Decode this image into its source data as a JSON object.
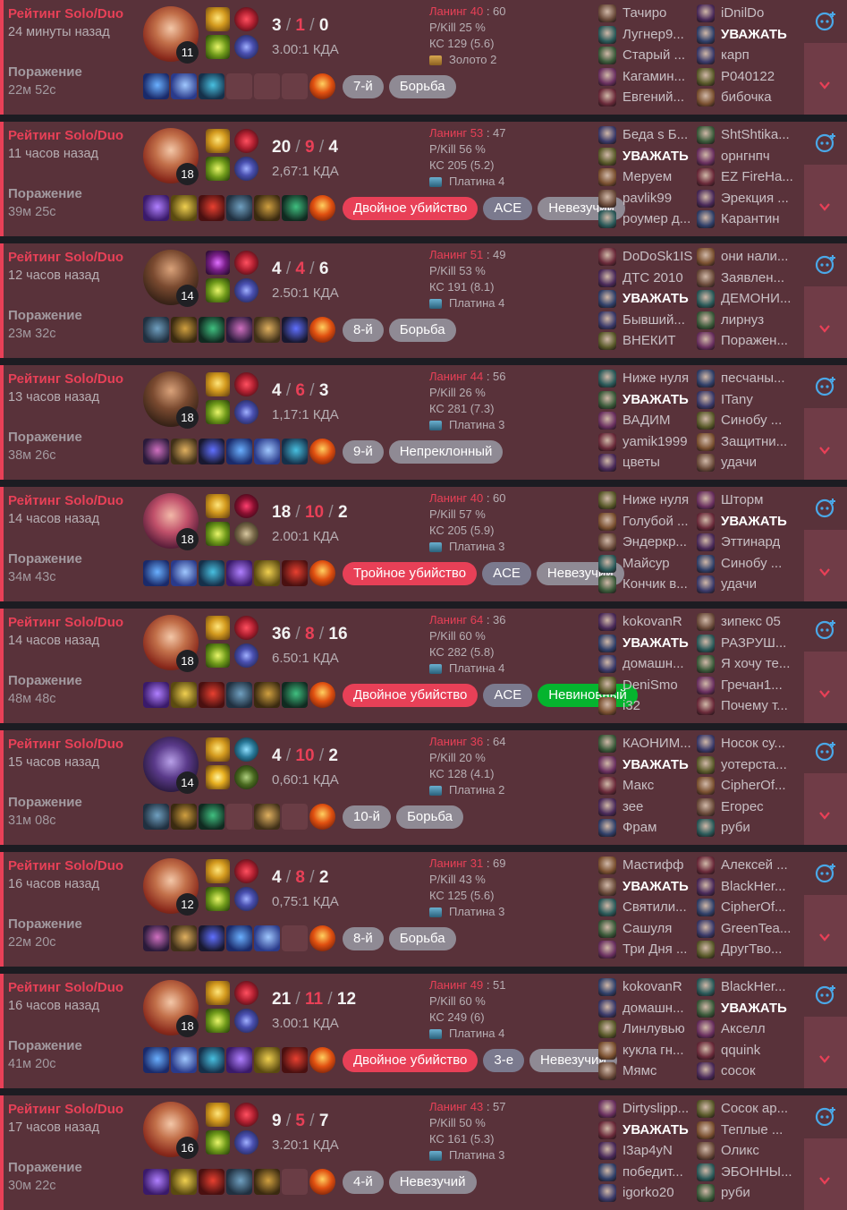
{
  "matches": [
    {
      "queue": "Рейтинг Solo/Duo",
      "time_ago": "24 минуты назад",
      "result": "Поражение",
      "duration": "22м 52с",
      "champion": "gragas",
      "level": "11",
      "spells": [
        "smite",
        "ghost"
      ],
      "runes": [
        "electrocute",
        "sorcery"
      ],
      "kda": {
        "k": "3",
        "d": "1",
        "a": "0"
      },
      "ratio": "3.00:1 КДА",
      "items": [
        "item",
        "item",
        "item",
        "empty",
        "empty",
        "empty",
        "ward"
      ],
      "tags": [
        {
          "label": "7-й",
          "style": "gray"
        },
        {
          "label": "Борьба",
          "style": "gray"
        }
      ],
      "lane_label": "Ланинг 40",
      "lane_score": ": 60",
      "pkill": "P/Kill 25 %",
      "cs": "КС 129 (5.6)",
      "rank": "Золото 2",
      "team1": [
        "Тачиро",
        "Лугнер9...",
        "Старый ...",
        "Кагамин...",
        "Евгений..."
      ],
      "team2": [
        "iDnilDo",
        "УВАЖАТЬ",
        "карп",
        "Р040122",
        "бибочка"
      ]
    },
    {
      "queue": "Рейтинг Solo/Duo",
      "time_ago": "11 часов назад",
      "result": "Поражение",
      "duration": "39м 25с",
      "champion": "gragas",
      "level": "18",
      "spells": [
        "smite",
        "ghost"
      ],
      "runes": [
        "electrocute",
        "sorcery"
      ],
      "kda": {
        "k": "20",
        "d": "9",
        "a": "4"
      },
      "ratio": "2,67:1 КДА",
      "items": [
        "item",
        "item",
        "item",
        "item",
        "item",
        "item",
        "ward"
      ],
      "tags": [
        {
          "label": "Двойное убийство",
          "style": "red"
        },
        {
          "label": "ACE",
          "style": "ace"
        },
        {
          "label": "Невезучий",
          "style": "gray"
        }
      ],
      "lane_label": "Ланинг 53",
      "lane_score": ": 47",
      "pkill": "P/Kill 56 %",
      "cs": "КС 205 (5.2)",
      "rank": "Платина 4",
      "team1": [
        "Беда s Б...",
        "УВАЖАТЬ",
        "Меруем",
        "pavlik99",
        "роумер д..."
      ],
      "team2": [
        "ShtShtika...",
        "орнгнпч",
        "EZ FireHa...",
        "Эрекция ...",
        "Карантин"
      ]
    },
    {
      "queue": "Рейтинг Solo/Duo",
      "time_ago": "12 часов назад",
      "result": "Поражение",
      "duration": "23м 32с",
      "champion": "graves",
      "level": "14",
      "spells": [
        "predator",
        "ghost"
      ],
      "runes": [
        "electrocute",
        "sorcery"
      ],
      "kda": {
        "k": "4",
        "d": "4",
        "a": "6"
      },
      "ratio": "2.50:1 КДА",
      "items": [
        "item",
        "item",
        "item",
        "item",
        "item",
        "item",
        "ward"
      ],
      "tags": [
        {
          "label": "8-й",
          "style": "gray"
        },
        {
          "label": "Борьба",
          "style": "gray"
        }
      ],
      "lane_label": "Ланинг 51",
      "lane_score": ": 49",
      "pkill": "P/Kill 53 %",
      "cs": "КС 191 (8.1)",
      "rank": "Платина 4",
      "team1": [
        "DoDoSk1IS",
        "ДТС 2010",
        "УВАЖАТЬ",
        "Бывший...",
        "ВНЕКИТ"
      ],
      "team2": [
        "они нали...",
        "Заявлен...",
        "ДЕМОНИ...",
        "лирнуз",
        "Поражен..."
      ]
    },
    {
      "queue": "Рейтинг Solo/Duo",
      "time_ago": "13 часов назад",
      "result": "Поражение",
      "duration": "38м 26с",
      "champion": "graves",
      "level": "18",
      "spells": [
        "smite",
        "ghost"
      ],
      "runes": [
        "electrocute",
        "sorcery"
      ],
      "kda": {
        "k": "4",
        "d": "6",
        "a": "3"
      },
      "ratio": "1,17:1 КДА",
      "items": [
        "item",
        "item",
        "item",
        "item",
        "item",
        "item",
        "ward"
      ],
      "tags": [
        {
          "label": "9-й",
          "style": "gray"
        },
        {
          "label": "Непреклонный",
          "style": "gray"
        }
      ],
      "lane_label": "Ланинг 44",
      "lane_score": ": 56",
      "pkill": "P/Kill 26 %",
      "cs": "КС 281 (7.3)",
      "rank": "Платина 3",
      "team1": [
        "Ниже нуля",
        "УВАЖАТЬ",
        "ВАДИМ",
        "yamik1999",
        "цветы"
      ],
      "team2": [
        "песчаны...",
        "ITany",
        "Синобу ...",
        "Защитни...",
        "удачи"
      ]
    },
    {
      "queue": "Рейтинг Solo/Duo",
      "time_ago": "14 часов назад",
      "result": "Поражение",
      "duration": "34м 43с",
      "champion": "vi",
      "level": "18",
      "spells": [
        "smite",
        "ghost"
      ],
      "runes": [
        "conqueror",
        "inspiration"
      ],
      "kda": {
        "k": "18",
        "d": "10",
        "a": "2"
      },
      "ratio": "2.00:1 КДА",
      "items": [
        "item",
        "item",
        "item",
        "item",
        "item",
        "item",
        "ward"
      ],
      "tags": [
        {
          "label": "Тройное убийство",
          "style": "red"
        },
        {
          "label": "ACE",
          "style": "ace"
        },
        {
          "label": "Невезучий",
          "style": "gray"
        }
      ],
      "lane_label": "Ланинг 40",
      "lane_score": ": 60",
      "pkill": "P/Kill 57 %",
      "cs": "КС 205 (5.9)",
      "rank": "Платина 3",
      "team1": [
        "Ниже нуля",
        "Голубой ...",
        "Эндеркр...",
        "Майсур",
        "Кончик в..."
      ],
      "team2": [
        "Шторм",
        "УВАЖАТЬ",
        "Эттинард",
        "Синобу ...",
        "удачи"
      ]
    },
    {
      "queue": "Рейтинг Solo/Duo",
      "time_ago": "14 часов назад",
      "result": "Поражение",
      "duration": "48м 48с",
      "champion": "gragas",
      "level": "18",
      "spells": [
        "smite",
        "ghost"
      ],
      "runes": [
        "electrocute",
        "sorcery"
      ],
      "kda": {
        "k": "36",
        "d": "8",
        "a": "16"
      },
      "ratio": "6.50:1 КДА",
      "items": [
        "item",
        "item",
        "item",
        "item",
        "item",
        "item",
        "ward"
      ],
      "tags": [
        {
          "label": "Двойное убийство",
          "style": "red"
        },
        {
          "label": "ACE",
          "style": "ace"
        },
        {
          "label": "Невиновный",
          "style": "green"
        }
      ],
      "lane_label": "Ланинг 64",
      "lane_score": ": 36",
      "pkill": "P/Kill 60 %",
      "cs": "КС 282 (5.8)",
      "rank": "Платина 4",
      "team1": [
        "kokovanR",
        "УВАЖАТЬ",
        "домашн...",
        "DeniSmo",
        "i32"
      ],
      "team2": [
        "зипекс 05",
        "РАЗРУШ...",
        "Я хочу те...",
        "Гречан1...",
        "Почему т..."
      ]
    },
    {
      "queue": "Рейтинг Solo/Duo",
      "time_ago": "15 часов назад",
      "result": "Поражение",
      "duration": "31м 08с",
      "champion": "kassadin",
      "level": "14",
      "spells": [
        "smite",
        "flash"
      ],
      "runes": [
        "aery",
        "resolve"
      ],
      "kda": {
        "k": "4",
        "d": "10",
        "a": "2"
      },
      "ratio": "0,60:1 КДА",
      "items": [
        "item",
        "item",
        "item",
        "empty",
        "item",
        "empty",
        "ward"
      ],
      "tags": [
        {
          "label": "10-й",
          "style": "gray"
        },
        {
          "label": "Борьба",
          "style": "gray"
        }
      ],
      "lane_label": "Ланинг 36",
      "lane_score": ": 64",
      "pkill": "P/Kill 20 %",
      "cs": "КС 128 (4.1)",
      "rank": "Платина 2",
      "team1": [
        "КАОНИМ...",
        "УВАЖАТЬ",
        "Макс",
        "зее",
        "Фрам"
      ],
      "team2": [
        "Носок су...",
        "уотерста...",
        "CipherOf...",
        "Егорес",
        "руби"
      ]
    },
    {
      "queue": "Рейтинг Solo/Duo",
      "time_ago": "16 часов назад",
      "result": "Поражение",
      "duration": "22м 20с",
      "champion": "gragas",
      "level": "12",
      "spells": [
        "smite",
        "ghost"
      ],
      "runes": [
        "electrocute",
        "sorcery"
      ],
      "kda": {
        "k": "4",
        "d": "8",
        "a": "2"
      },
      "ratio": "0,75:1 КДА",
      "items": [
        "item",
        "item",
        "item",
        "item",
        "item",
        "empty",
        "ward"
      ],
      "tags": [
        {
          "label": "8-й",
          "style": "gray"
        },
        {
          "label": "Борьба",
          "style": "gray"
        }
      ],
      "lane_label": "Ланинг 31",
      "lane_score": ": 69",
      "pkill": "P/Kill 43 %",
      "cs": "КС 125 (5.6)",
      "rank": "Платина 3",
      "team1": [
        "Мастифф",
        "УВАЖАТЬ",
        "Святили...",
        "Сашуля",
        "Три Дня ..."
      ],
      "team2": [
        "Алексей ...",
        "BlackHer...",
        "CipherOf...",
        "GreenTea...",
        "ДругТво..."
      ]
    },
    {
      "queue": "Рейтинг Solo/Duo",
      "time_ago": "16 часов назад",
      "result": "Поражение",
      "duration": "41м 20с",
      "champion": "gragas",
      "level": "18",
      "spells": [
        "smite",
        "ghost"
      ],
      "runes": [
        "electrocute",
        "sorcery"
      ],
      "kda": {
        "k": "21",
        "d": "11",
        "a": "12"
      },
      "ratio": "3.00:1 КДА",
      "items": [
        "item",
        "item",
        "item",
        "item",
        "item",
        "item",
        "ward"
      ],
      "tags": [
        {
          "label": "Двойное убийство",
          "style": "red"
        },
        {
          "label": "3-е",
          "style": "ace"
        },
        {
          "label": "Невезучий",
          "style": "gray"
        }
      ],
      "lane_label": "Ланинг 49",
      "lane_score": ": 51",
      "pkill": "P/Kill 60 %",
      "cs": "КС 249 (6)",
      "rank": "Платина 4",
      "team1": [
        "kokovanR",
        "домашн...",
        "Линлувью",
        "кукла гн...",
        "Мямс"
      ],
      "team2": [
        "BlackHer...",
        "УВАЖАТЬ",
        "Акселл",
        "qquink",
        "сосок"
      ]
    },
    {
      "queue": "Рейтинг Solo/Duo",
      "time_ago": "17 часов назад",
      "result": "Поражение",
      "duration": "30м 22с",
      "champion": "gragas",
      "level": "16",
      "spells": [
        "smite",
        "ghost"
      ],
      "runes": [
        "electrocute",
        "sorcery"
      ],
      "kda": {
        "k": "9",
        "d": "5",
        "a": "7"
      },
      "ratio": "3.20:1 КДА",
      "items": [
        "item",
        "item",
        "item",
        "item",
        "item",
        "empty",
        "ward"
      ],
      "tags": [
        {
          "label": "4-й",
          "style": "gray"
        },
        {
          "label": "Невезучий",
          "style": "gray"
        }
      ],
      "lane_label": "Ланинг 43",
      "lane_score": ": 57",
      "pkill": "P/Kill 50 %",
      "cs": "КС 161 (5.3)",
      "rank": "Платина 3",
      "team1": [
        "Dirtyslipp...",
        "УВАЖАТЬ",
        "I3ap4yN",
        "победит...",
        "igorko20"
      ],
      "team2": [
        "Сосок ар...",
        "Теплые ...",
        "Оликс",
        "ЭБОННЫ...",
        "руби"
      ]
    }
  ],
  "colors": {
    "loss_bg": "#59323a",
    "accent": "#e84057",
    "side_bg": "#703c47"
  }
}
